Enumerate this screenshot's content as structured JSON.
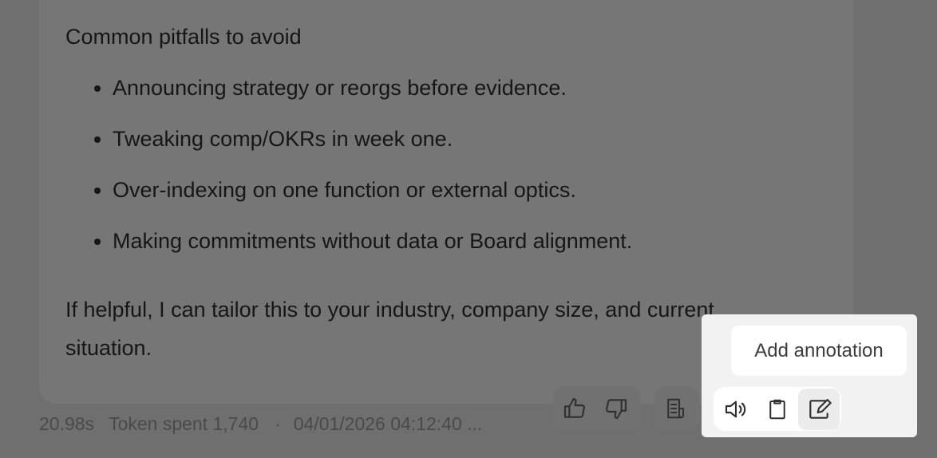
{
  "message": {
    "heading": "Common pitfalls to avoid",
    "pitfalls": [
      "Announcing strategy or reorgs before evidence.",
      "Tweaking comp/OKRs in week one.",
      "Over-indexing on one function or external optics.",
      "Making commitments without data or Board alignment."
    ],
    "closing_line1": "If helpful, I can tailor this to your industry, company size, and current",
    "closing_line2": "situation."
  },
  "meta": {
    "duration": "20.98s",
    "tokens": "Token spent 1,740",
    "separator": "·",
    "timestamp": "04/01/2026 04:12:40 ..."
  },
  "actions": {
    "feedback": [
      "thumbs-up-icon",
      "thumbs-down-icon"
    ],
    "annotation_log": "document-list-icon",
    "popover_toolbar": [
      "speaker-icon",
      "clipboard-icon",
      "edit-note-icon"
    ]
  },
  "tooltip": {
    "label": "Add annotation"
  }
}
